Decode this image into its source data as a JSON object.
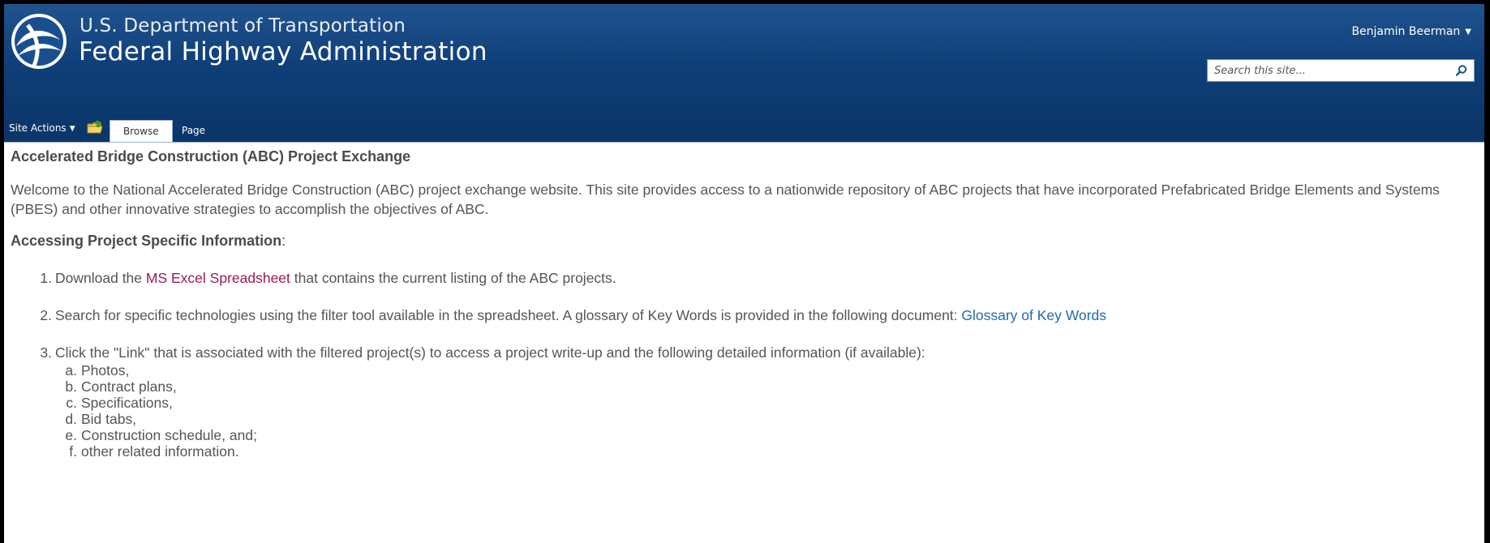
{
  "header": {
    "agency_line1": "U.S. Department of Transportation",
    "agency_line2": "Federal Highway Administration",
    "user_name": "Benjamin Beerman",
    "search_placeholder": "Search this site..."
  },
  "ribbon": {
    "site_actions": "Site Actions",
    "tabs": [
      {
        "label": "Browse",
        "selected": true
      },
      {
        "label": "Page",
        "selected": false
      }
    ]
  },
  "content": {
    "title": "Accelerated Bridge Construction (ABC) Project Exchange",
    "intro": "Welcome to the National Accelerated Bridge Construction (ABC) project exchange website. This site provides access to a nationwide repository of ABC projects that have incorporated Prefabricated Bridge Elements and Systems (PBES) and other innovative strategies to accomplish the objectives of ABC.",
    "section_heading": "Accessing Project Specific Information",
    "section_heading_suffix": ":",
    "steps": [
      {
        "num": "1.",
        "before": "Download the ",
        "link": "MS Excel Spreadsheet",
        "after": " that contains the current listing of the ABC projects."
      },
      {
        "num": "2.",
        "before": "Search for specific technologies using the filter tool available in the spreadsheet. A glossary of Key Words is provided in the following document: ",
        "link": "Glossary of Key Words",
        "after": ""
      },
      {
        "num": "3.",
        "before": "Click the \"Link\" that is associated with the filtered project(s) to access a project write-up and the following detailed information (if available):",
        "link": "",
        "after": ""
      }
    ],
    "subitems": [
      {
        "num": "a.",
        "text": "Photos,"
      },
      {
        "num": "b.",
        "text": "Contract plans,"
      },
      {
        "num": "c.",
        "text": "Specifications,"
      },
      {
        "num": "d.",
        "text": "Bid tabs,"
      },
      {
        "num": "e.",
        "text": "Construction schedule, and;"
      },
      {
        "num": "f.",
        "text": "other related information."
      }
    ]
  },
  "colors": {
    "header_blue": "#0f3f78",
    "link_visited": "#9b1b55",
    "link": "#1e6bb0",
    "text": "#555555"
  },
  "icons": [
    "dot-logo-icon",
    "chevron-down-icon",
    "folder-up-icon",
    "magnifier-icon"
  ]
}
